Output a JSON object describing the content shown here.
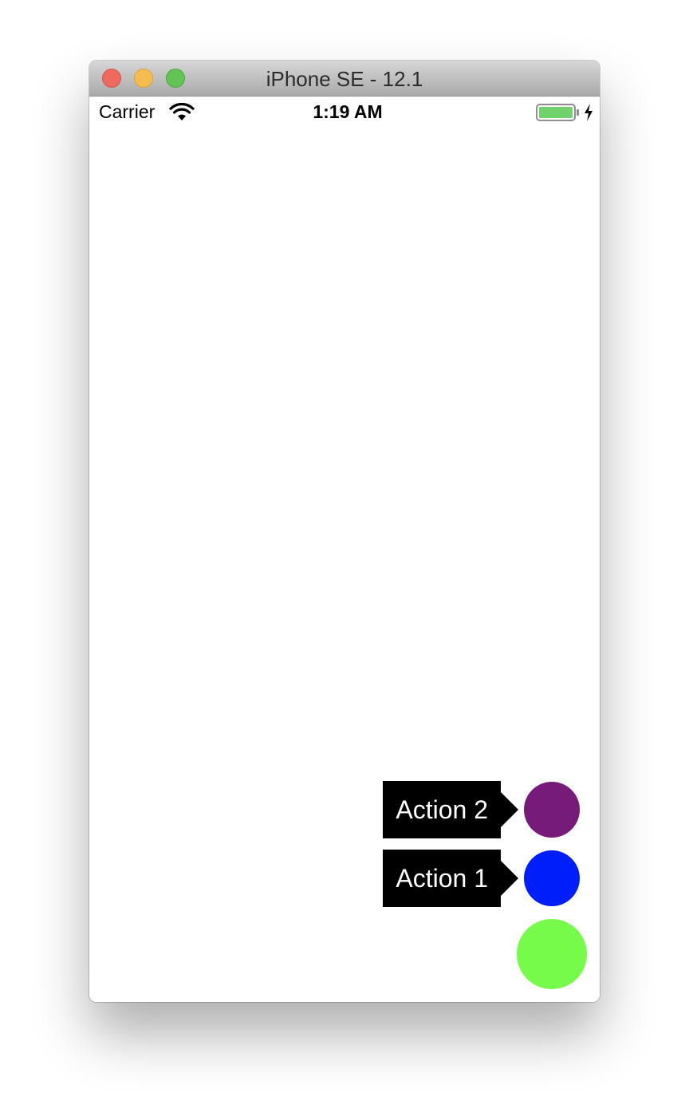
{
  "window": {
    "title": "iPhone SE - 12.1"
  },
  "status_bar": {
    "carrier": "Carrier",
    "time": "1:19 AM",
    "wifi_icon": "wifi-icon",
    "battery_icon": "battery-full-icon",
    "charging_icon": "charging-bolt-icon",
    "battery_color": "#6fd26a"
  },
  "fab_menu": {
    "actions": [
      {
        "label": "Action 2",
        "color": "#771b7b"
      },
      {
        "label": "Action 1",
        "color": "#001ef9"
      }
    ],
    "main_button_color": "#76fb4a"
  }
}
